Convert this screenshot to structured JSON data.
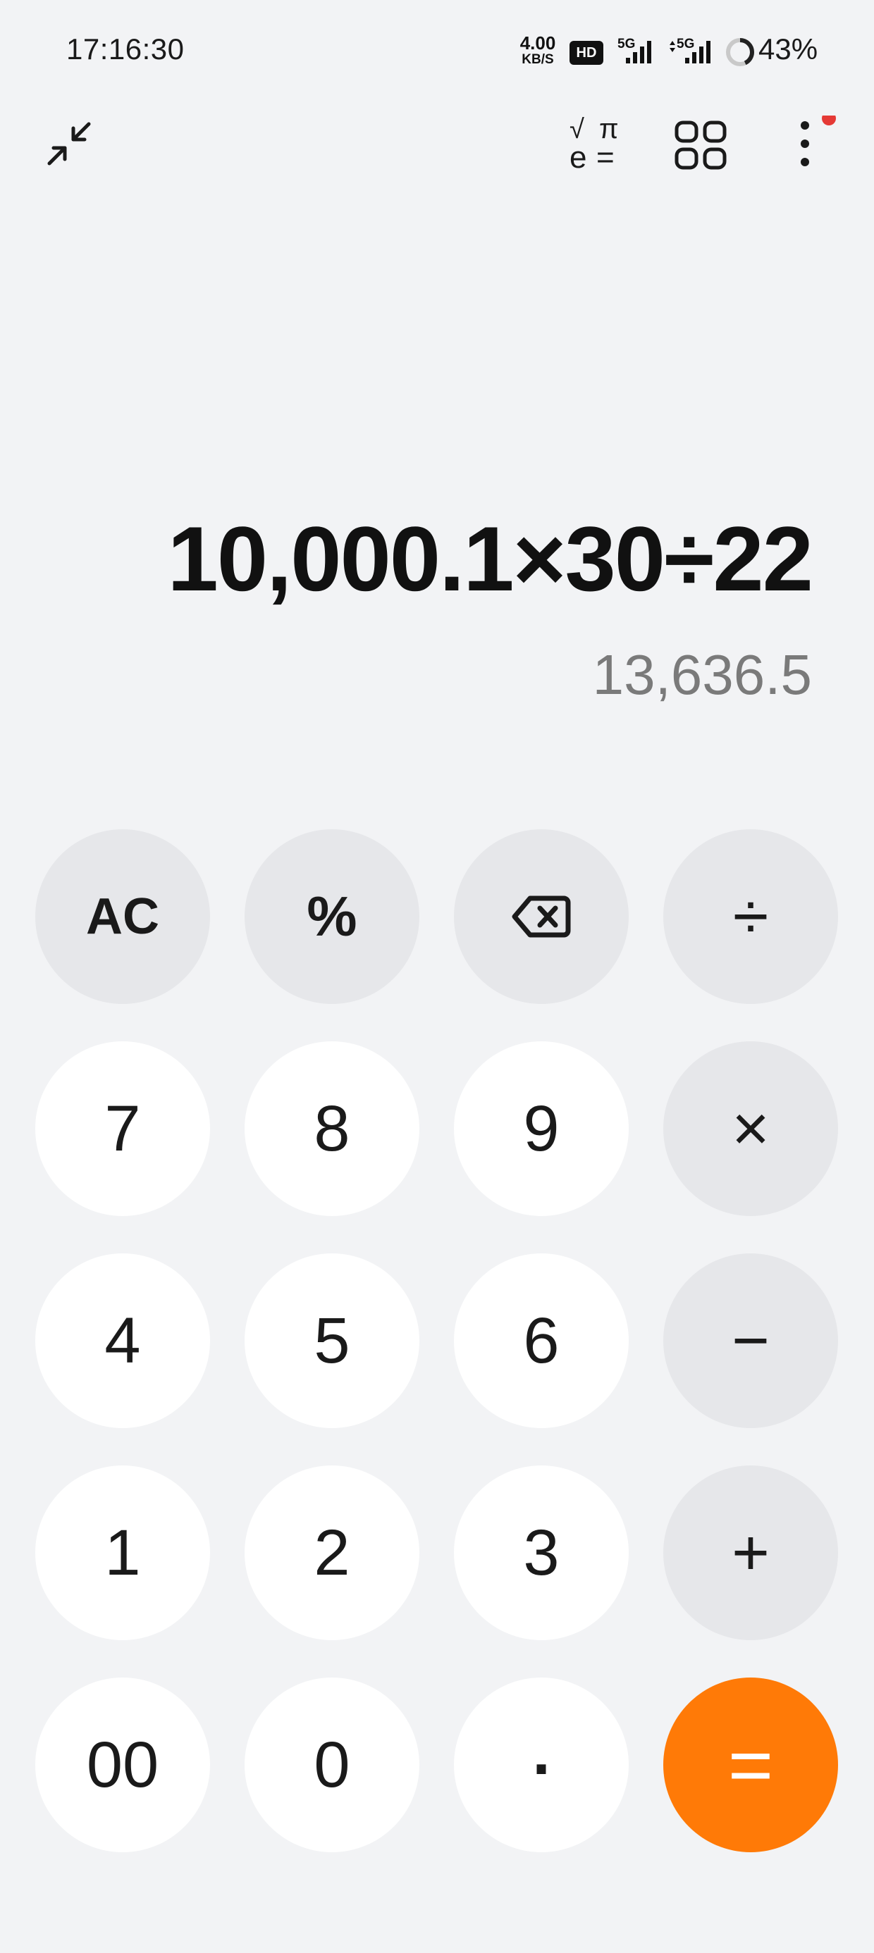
{
  "status_bar": {
    "time": "17:16:30",
    "net_speed_value": "4.00",
    "net_speed_unit": "KB/S",
    "hd_badge": "HD",
    "signal_1_label": "5G",
    "signal_2_label": "5G",
    "battery_percent": "43%",
    "battery_level": 0.43,
    "icons": [
      "signal-icon",
      "signal-icon",
      "battery-ring-icon"
    ]
  },
  "toolbar": {
    "icons": [
      "collapse-icon",
      "scientific-mode-icon",
      "grid-icon",
      "more-icon"
    ],
    "sci_symbols": {
      "sqrt": "√",
      "pi": "π",
      "e": "e",
      "eq": "="
    },
    "notification_dot_color": "#e53935"
  },
  "display": {
    "expression": "10,000.1×30÷22",
    "result": "13,636.5"
  },
  "keys": [
    {
      "label": "AC",
      "type": "function"
    },
    {
      "label": "%",
      "type": "function"
    },
    {
      "label": "",
      "type": "function",
      "icon": "backspace-icon"
    },
    {
      "label": "÷",
      "type": "operator"
    },
    {
      "label": "7",
      "type": "digit"
    },
    {
      "label": "8",
      "type": "digit"
    },
    {
      "label": "9",
      "type": "digit"
    },
    {
      "label": "×",
      "type": "operator"
    },
    {
      "label": "4",
      "type": "digit"
    },
    {
      "label": "5",
      "type": "digit"
    },
    {
      "label": "6",
      "type": "digit"
    },
    {
      "label": "−",
      "type": "operator"
    },
    {
      "label": "1",
      "type": "digit"
    },
    {
      "label": "2",
      "type": "digit"
    },
    {
      "label": "3",
      "type": "digit"
    },
    {
      "label": "+",
      "type": "operator"
    },
    {
      "label": "00",
      "type": "digit"
    },
    {
      "label": "0",
      "type": "digit"
    },
    {
      "label": ".",
      "type": "digit"
    },
    {
      "label": "=",
      "type": "equals"
    }
  ],
  "colors": {
    "background": "#f2f3f5",
    "digit_key": "#ffffff",
    "function_key": "#e6e7ea",
    "equals_key": "#ff7a07",
    "equals_text": "#ffffff",
    "result_text": "#7a7a7a"
  }
}
